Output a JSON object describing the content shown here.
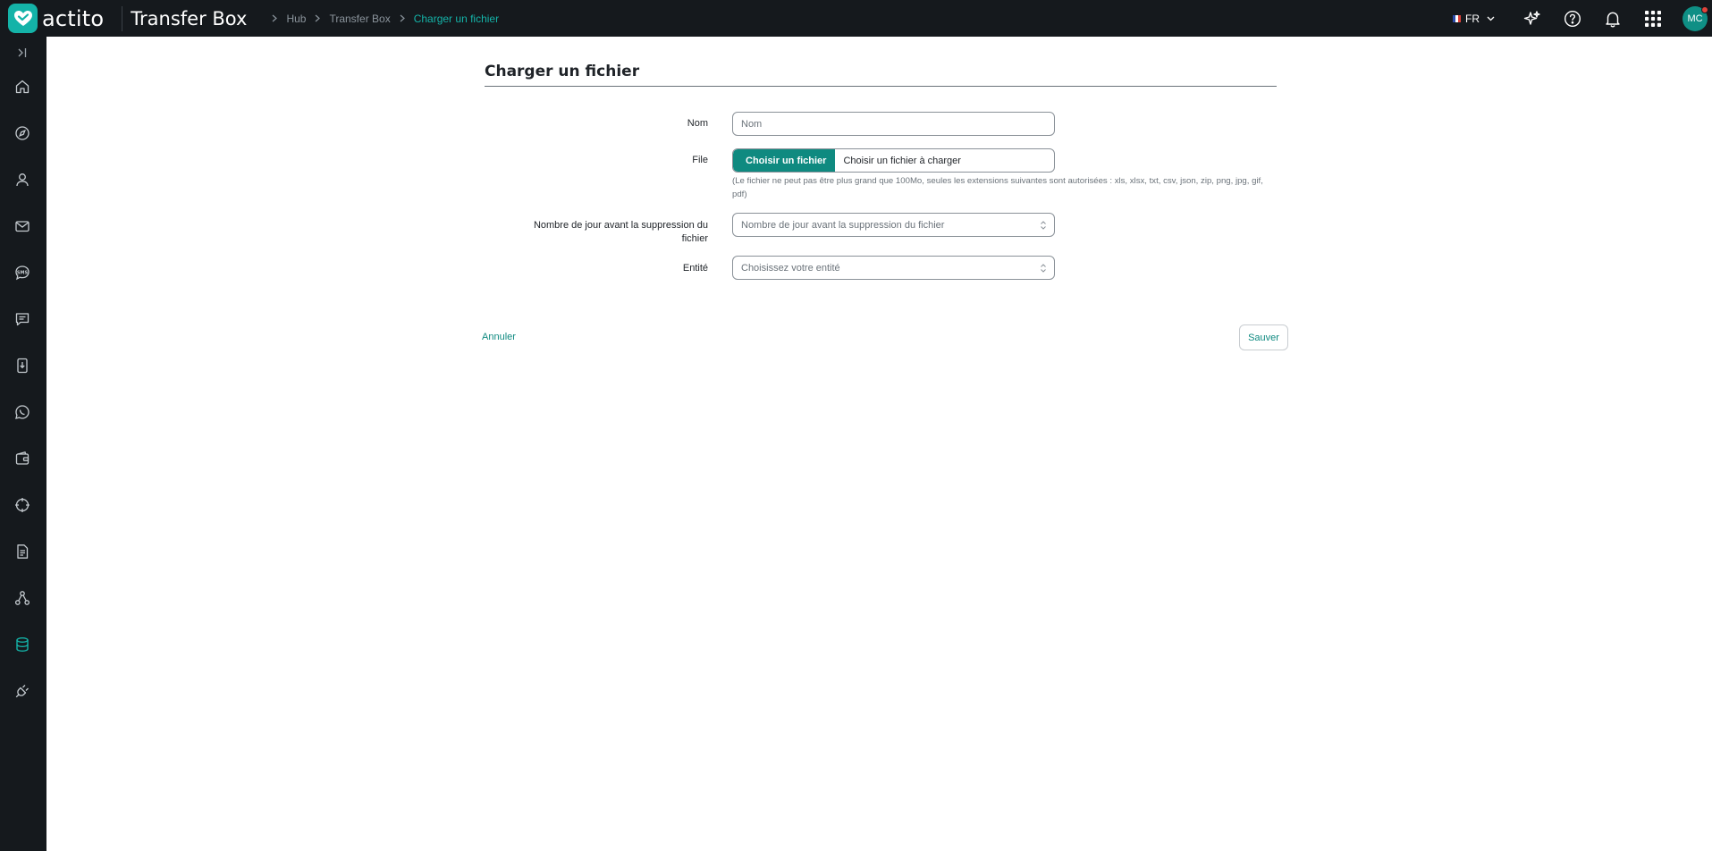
{
  "brand": {
    "name": "actito",
    "accent": "#14b3a8",
    "icon": "heart-logo-icon"
  },
  "header": {
    "app_title": "Transfer Box",
    "breadcrumb": [
      "Hub",
      "Transfer Box",
      "Charger un fichier"
    ],
    "language": "FR",
    "avatar_initials": "MC",
    "icons": [
      "sparkle-icon",
      "help-icon",
      "bell-icon",
      "apps-grid-icon"
    ]
  },
  "sidebar": {
    "items": [
      {
        "icon": "collapse-sidebar-icon"
      },
      {
        "icon": "home-icon"
      },
      {
        "icon": "compass-icon"
      },
      {
        "icon": "user-icon"
      },
      {
        "icon": "mail-icon"
      },
      {
        "icon": "sms-icon"
      },
      {
        "icon": "chat-icon"
      },
      {
        "icon": "mobile-download-icon"
      },
      {
        "icon": "whatsapp-icon"
      },
      {
        "icon": "wallet-icon"
      },
      {
        "icon": "target-icon"
      },
      {
        "icon": "document-icon"
      },
      {
        "icon": "workflow-icon"
      },
      {
        "icon": "database-icon",
        "active": true
      },
      {
        "icon": "plug-icon"
      }
    ]
  },
  "page": {
    "title": "Charger un fichier",
    "form": {
      "name_label": "Nom",
      "name_placeholder": "Nom",
      "file_label": "File",
      "file_button": "Choisir un fichier",
      "file_placeholder": "Choisir un fichier à charger",
      "file_help": "(Le fichier ne peut pas être plus grand que 100Mo, seules les extensions suivantes sont autorisées : xls, xlsx, txt, csv, json, zip, png, jpg, gif, pdf)",
      "days_label": "Nombre de jour avant la suppression du fichier",
      "days_placeholder": "Nombre de jour avant la suppression du fichier",
      "entity_label": "Entité",
      "entity_placeholder": "Choisissez votre entité"
    },
    "cancel_label": "Annuler",
    "save_label": "Sauver"
  }
}
